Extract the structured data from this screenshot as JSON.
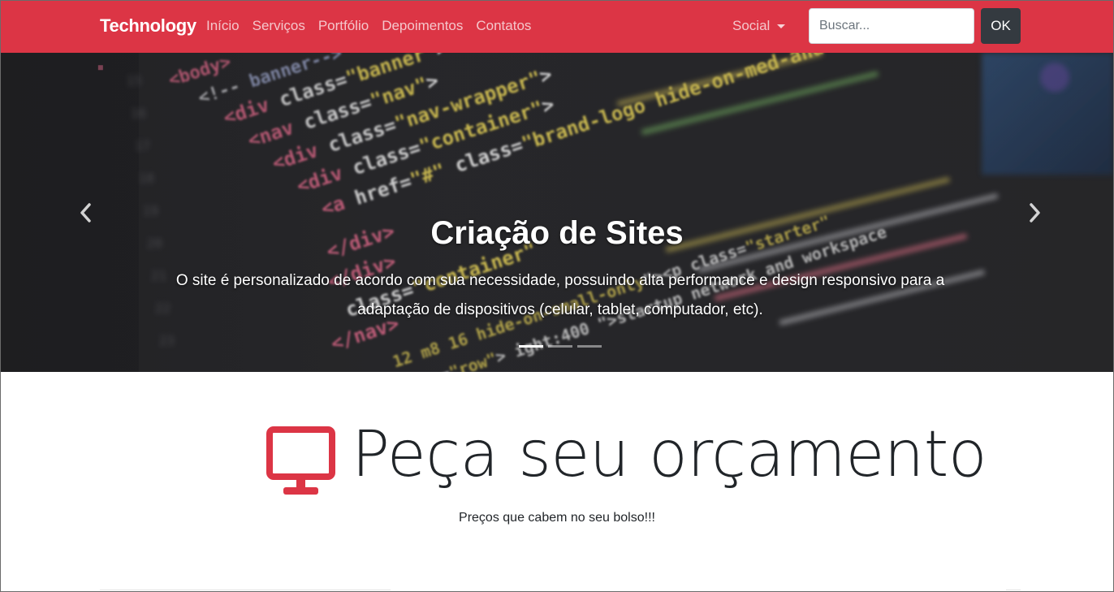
{
  "navbar": {
    "brand": "Technology",
    "links": [
      "Início",
      "Serviços",
      "Portfólio",
      "Depoimentos",
      "Contatos"
    ],
    "social_label": "Social",
    "search_placeholder": "Buscar...",
    "search_button": "OK",
    "background_color": "#dc3545"
  },
  "carousel": {
    "title": "Criação de Sites",
    "text": "O site é personalizado de acordo com sua necessidade, possuindo alta performance e design responsivo para a adaptação de dispositivos (celular, tablet, computador, etc).",
    "slide_count": 3,
    "active_slide": 0,
    "prev_icon": "chevron-left-icon",
    "next_icon": "chevron-right-icon"
  },
  "main": {
    "title": "Peça seu orçamento",
    "subtitle": "Preços que cabem no seu bolso!!!",
    "title_icon": "monitor-icon",
    "accent_color": "#dc3545"
  }
}
